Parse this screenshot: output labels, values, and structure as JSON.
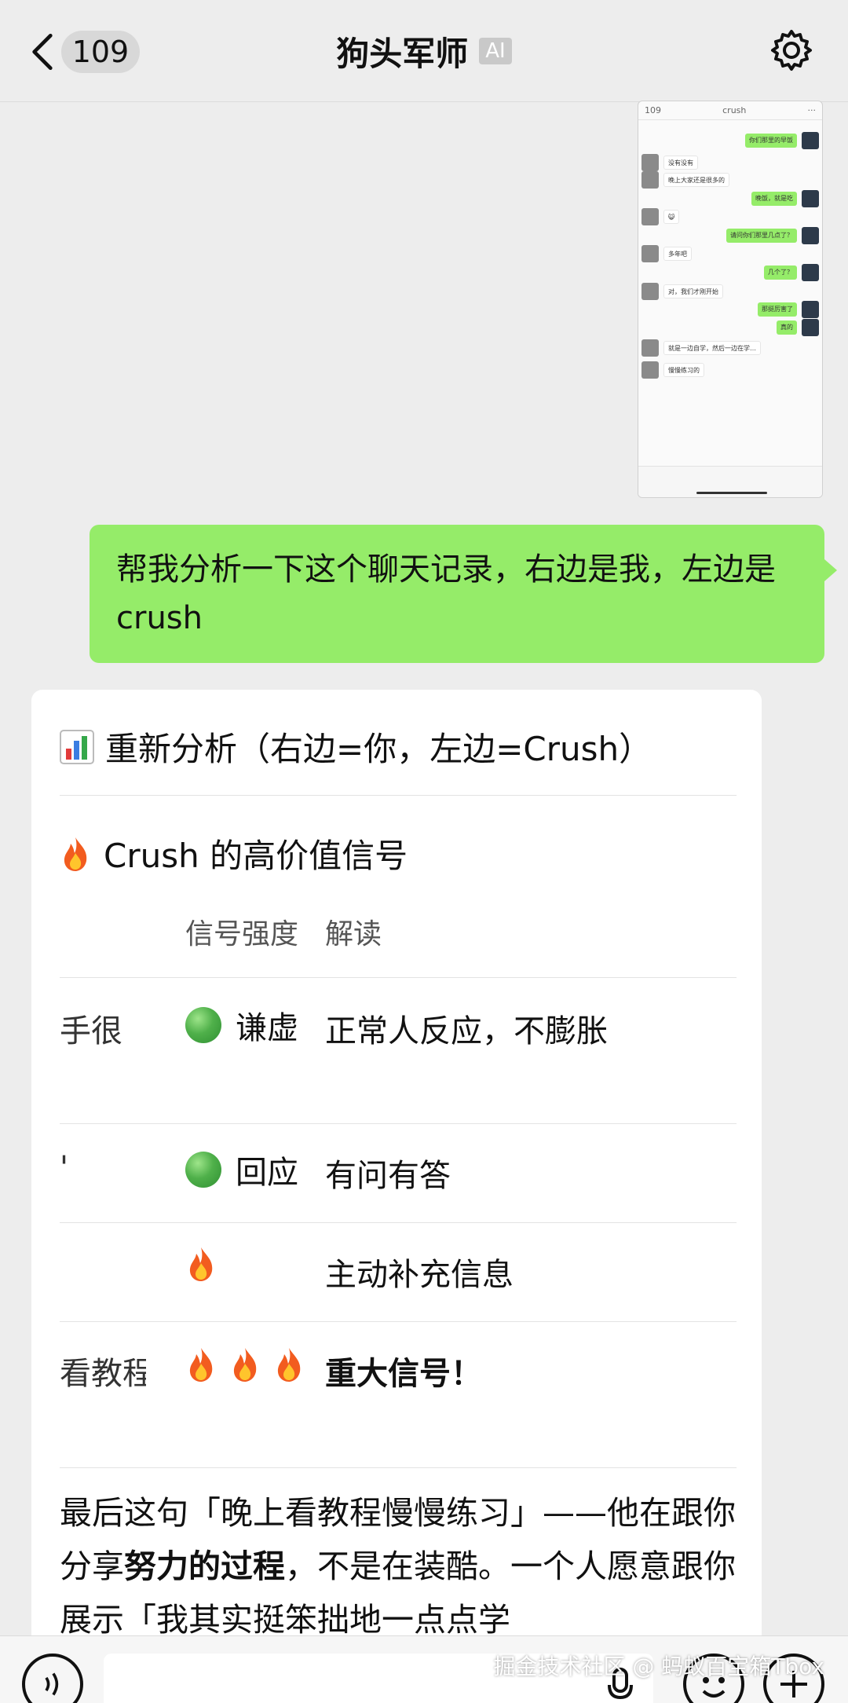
{
  "header": {
    "unread_count": "109",
    "title": "狗头军师",
    "ai_tag": "AI"
  },
  "screenshot_message": {
    "title": "crush",
    "unread": "109",
    "rows": [
      {
        "side": "right",
        "text": "你们那里的早饭"
      },
      {
        "side": "left",
        "text": "没有没有"
      },
      {
        "side": "left",
        "text": "晚上大家还是很多的"
      },
      {
        "side": "right",
        "text": "晚饭，就是吃"
      },
      {
        "side": "left",
        "text": "😺"
      },
      {
        "side": "right",
        "text": "请问你们那里几点了？"
      },
      {
        "side": "left",
        "text": "多年吧"
      },
      {
        "side": "right",
        "text": "几个了？"
      },
      {
        "side": "left",
        "text": "对，我们才刚开始"
      },
      {
        "side": "right",
        "text": "那挺厉害了"
      },
      {
        "side": "right",
        "text": "真的"
      },
      {
        "side": "left",
        "text": "就是一边自学，然后一边在学…"
      },
      {
        "side": "left",
        "text": "慢慢练习的"
      }
    ]
  },
  "user_message": {
    "text": "帮我分析一下这个聊天记录，右边是我，左边是 crush"
  },
  "ai_reply": {
    "heading": "重新分析（右边=你，左边=Crush）",
    "section_title": "Crush 的高价值信号",
    "table": {
      "headers": [
        "信号强度",
        "解读"
      ],
      "rows": [
        {
          "col1": "手很",
          "strength": "谦虚",
          "reading": "正常人反应，不膨胀",
          "icon": "green-circle",
          "reading_bold": false
        },
        {
          "col1": "'",
          "strength": "回应",
          "reading": "有问有答",
          "icon": "green-circle",
          "reading_bold": false
        },
        {
          "col1": "",
          "strength": "",
          "reading": "主动补充信息",
          "icon": "fire",
          "reading_bold": false
        },
        {
          "col1": "看教程",
          "strength": "",
          "reading": "重大信号！",
          "icon": "fire-x3",
          "reading_bold": true
        }
      ]
    },
    "paragraph": {
      "part1": "最后这句「晚上看教程慢慢练习」——他在跟你分享",
      "bold": "努力的过程",
      "part2": "，不是在装酷。一个人愿意跟你展示「我其实挺笨拙地一点点学"
    }
  },
  "watermark": "掘金技术社区 @ 蚂蚁百宝箱Tbox",
  "colors": {
    "background": "#ededed",
    "user_bubble": "#95ec69",
    "card": "#ffffff"
  }
}
